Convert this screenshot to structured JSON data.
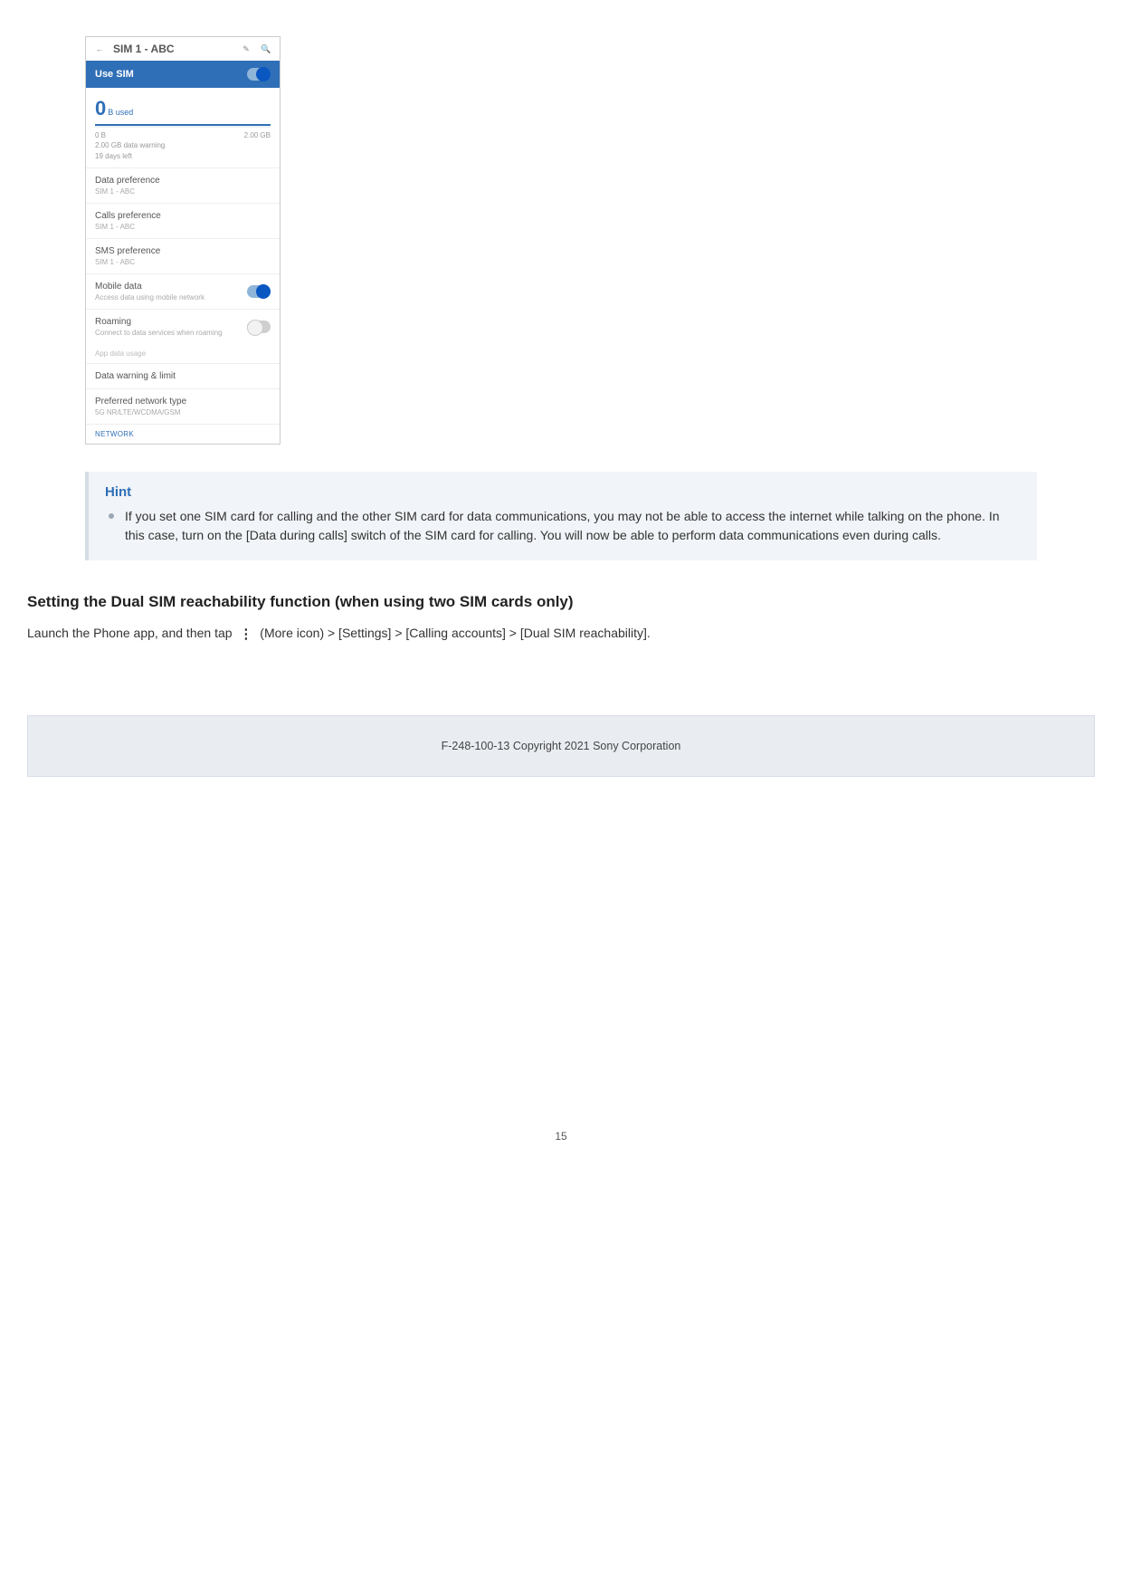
{
  "phone": {
    "title": "SIM 1 - ABC",
    "use_sim_label": "Use SIM",
    "usage": {
      "big_value": "0",
      "unit": "B used",
      "left_tick": "0 B",
      "right_tick": "2.00 GB",
      "warning_line1": "2.00 GB data warning",
      "warning_line2": "19 days left"
    },
    "data_pref": {
      "lbl": "Data preference",
      "sub": "SIM 1 - ABC"
    },
    "calls_pref": {
      "lbl": "Calls preference",
      "sub": "SIM 1 - ABC"
    },
    "sms_pref": {
      "lbl": "SMS preference",
      "sub": "SIM 1 - ABC"
    },
    "mobile_data": {
      "lbl": "Mobile data",
      "sub": "Access data using mobile network"
    },
    "roaming": {
      "lbl": "Roaming",
      "sub": "Connect to data services when roaming"
    },
    "app_usage": "App data usage",
    "warning_limit": "Data warning & limit",
    "pref_net": {
      "lbl": "Preferred network type",
      "sub": "5G NR/LTE/WCDMA/GSM"
    },
    "network_footer": "NETWORK"
  },
  "hint": {
    "title": "Hint",
    "text": "If you set one SIM card for calling and the other SIM card for data communications, you may not be able to access the internet while talking on the phone. In this case, turn on the [Data during calls] switch of the SIM card for calling. You will now be able to perform data communications even during calls."
  },
  "heading": "Setting the Dual SIM reachability function (when using two SIM cards only)",
  "body": {
    "prefix": "Launch the Phone app, and then tap ",
    "more_icon_label": " (More icon) > [Settings] > [Calling accounts] > [Dual SIM reachability]."
  },
  "footer": "F-248-100-13 Copyright 2021 Sony Corporation",
  "page_number": "15"
}
